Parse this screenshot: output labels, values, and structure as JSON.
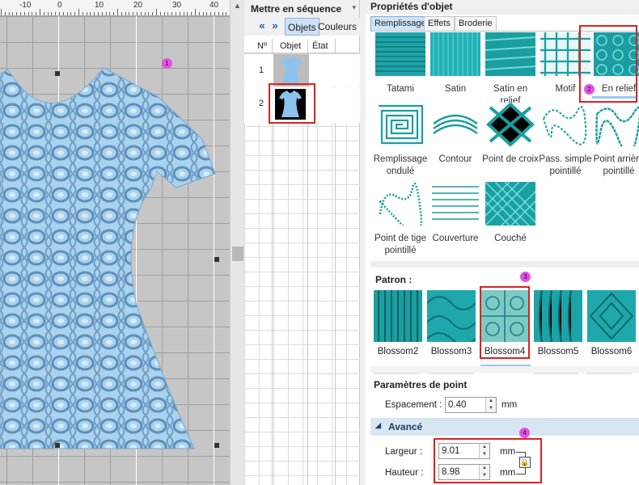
{
  "canvas": {
    "ruler_labels": [
      "-10",
      "0",
      "10",
      "20",
      "30",
      "40"
    ],
    "markers": [
      "1"
    ]
  },
  "sequence": {
    "title": "Mettre en séquence",
    "tabs": [
      "Objets",
      "Couleurs"
    ],
    "columns": [
      "Nº",
      "Objet",
      "État"
    ],
    "rows": [
      {
        "num": "1"
      },
      {
        "num": "2"
      }
    ]
  },
  "properties": {
    "title": "Propriétés d'objet",
    "tabs": [
      "Remplissage",
      "Effets",
      "Broderie"
    ],
    "fills": [
      {
        "label": "Tatami",
        "icon": "tatami-swatch"
      },
      {
        "label": "Satin",
        "icon": "satin-swatch"
      },
      {
        "label": "Satin en relief",
        "icon": "raised-satin-swatch"
      },
      {
        "label": "Motif",
        "icon": "motif-swatch"
      },
      {
        "label": "En relief",
        "icon": "relief-swatch"
      },
      {
        "label": "Remplissage ondulé",
        "icon": "wave-fill-swatch"
      },
      {
        "label": "Contour",
        "icon": "contour-swatch"
      },
      {
        "label": "Point de croix",
        "icon": "cross-stitch-swatch"
      },
      {
        "label": "Pass. simple pointillé",
        "icon": "stipple-run-swatch"
      },
      {
        "label": "Point arrière pointillé",
        "icon": "stipple-backstitch-swatch"
      },
      {
        "label": "Point de tige pointillé",
        "icon": "stipple-stem-swatch"
      },
      {
        "label": "Couverture",
        "icon": "blanket-swatch"
      },
      {
        "label": "Couché",
        "icon": "couching-swatch"
      }
    ],
    "selected_fill": "En relief",
    "pattern_label": "Patron :",
    "patterns": [
      "Blossom2",
      "Blossom3",
      "Blossom4",
      "Blossom5",
      "Blossom6"
    ],
    "selected_pattern": "Blossom4",
    "stitch_params_label": "Paramètres de point",
    "spacing": {
      "label": "Espacement :",
      "value": "0.40",
      "unit": "mm"
    },
    "advanced_label": "Avancé",
    "width": {
      "label": "Largeur :",
      "value": "9.01",
      "unit": "mm"
    },
    "height": {
      "label": "Hauteur :",
      "value": "8.98",
      "unit": "mm"
    },
    "step_markers": [
      "2",
      "3",
      "4"
    ]
  },
  "colors": {
    "accent": "#1a9ea0",
    "dress": "#9ec9ea",
    "highlight_box": "#e02020",
    "marker": "#e651e6"
  }
}
